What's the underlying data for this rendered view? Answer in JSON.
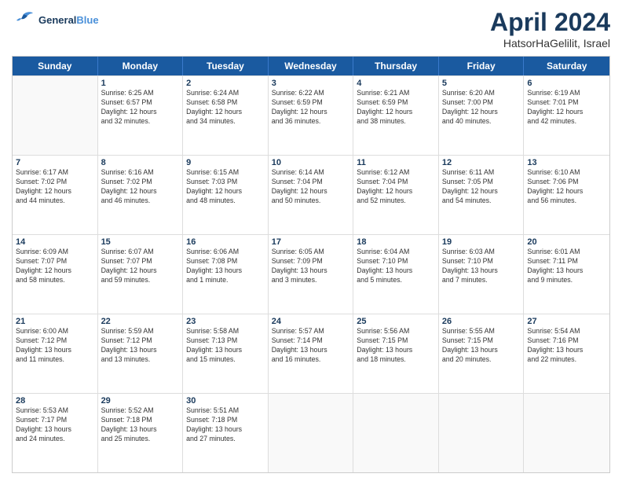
{
  "header": {
    "logo_line1": "General",
    "logo_line2": "Blue",
    "month": "April 2024",
    "location": "HatsorHaGelilit, Israel"
  },
  "days": [
    "Sunday",
    "Monday",
    "Tuesday",
    "Wednesday",
    "Thursday",
    "Friday",
    "Saturday"
  ],
  "weeks": [
    [
      {
        "day": "",
        "text": ""
      },
      {
        "day": "1",
        "text": "Sunrise: 6:25 AM\nSunset: 6:57 PM\nDaylight: 12 hours\nand 32 minutes."
      },
      {
        "day": "2",
        "text": "Sunrise: 6:24 AM\nSunset: 6:58 PM\nDaylight: 12 hours\nand 34 minutes."
      },
      {
        "day": "3",
        "text": "Sunrise: 6:22 AM\nSunset: 6:59 PM\nDaylight: 12 hours\nand 36 minutes."
      },
      {
        "day": "4",
        "text": "Sunrise: 6:21 AM\nSunset: 6:59 PM\nDaylight: 12 hours\nand 38 minutes."
      },
      {
        "day": "5",
        "text": "Sunrise: 6:20 AM\nSunset: 7:00 PM\nDaylight: 12 hours\nand 40 minutes."
      },
      {
        "day": "6",
        "text": "Sunrise: 6:19 AM\nSunset: 7:01 PM\nDaylight: 12 hours\nand 42 minutes."
      }
    ],
    [
      {
        "day": "7",
        "text": "Sunrise: 6:17 AM\nSunset: 7:02 PM\nDaylight: 12 hours\nand 44 minutes."
      },
      {
        "day": "8",
        "text": "Sunrise: 6:16 AM\nSunset: 7:02 PM\nDaylight: 12 hours\nand 46 minutes."
      },
      {
        "day": "9",
        "text": "Sunrise: 6:15 AM\nSunset: 7:03 PM\nDaylight: 12 hours\nand 48 minutes."
      },
      {
        "day": "10",
        "text": "Sunrise: 6:14 AM\nSunset: 7:04 PM\nDaylight: 12 hours\nand 50 minutes."
      },
      {
        "day": "11",
        "text": "Sunrise: 6:12 AM\nSunset: 7:04 PM\nDaylight: 12 hours\nand 52 minutes."
      },
      {
        "day": "12",
        "text": "Sunrise: 6:11 AM\nSunset: 7:05 PM\nDaylight: 12 hours\nand 54 minutes."
      },
      {
        "day": "13",
        "text": "Sunrise: 6:10 AM\nSunset: 7:06 PM\nDaylight: 12 hours\nand 56 minutes."
      }
    ],
    [
      {
        "day": "14",
        "text": "Sunrise: 6:09 AM\nSunset: 7:07 PM\nDaylight: 12 hours\nand 58 minutes."
      },
      {
        "day": "15",
        "text": "Sunrise: 6:07 AM\nSunset: 7:07 PM\nDaylight: 12 hours\nand 59 minutes."
      },
      {
        "day": "16",
        "text": "Sunrise: 6:06 AM\nSunset: 7:08 PM\nDaylight: 13 hours\nand 1 minute."
      },
      {
        "day": "17",
        "text": "Sunrise: 6:05 AM\nSunset: 7:09 PM\nDaylight: 13 hours\nand 3 minutes."
      },
      {
        "day": "18",
        "text": "Sunrise: 6:04 AM\nSunset: 7:10 PM\nDaylight: 13 hours\nand 5 minutes."
      },
      {
        "day": "19",
        "text": "Sunrise: 6:03 AM\nSunset: 7:10 PM\nDaylight: 13 hours\nand 7 minutes."
      },
      {
        "day": "20",
        "text": "Sunrise: 6:01 AM\nSunset: 7:11 PM\nDaylight: 13 hours\nand 9 minutes."
      }
    ],
    [
      {
        "day": "21",
        "text": "Sunrise: 6:00 AM\nSunset: 7:12 PM\nDaylight: 13 hours\nand 11 minutes."
      },
      {
        "day": "22",
        "text": "Sunrise: 5:59 AM\nSunset: 7:12 PM\nDaylight: 13 hours\nand 13 minutes."
      },
      {
        "day": "23",
        "text": "Sunrise: 5:58 AM\nSunset: 7:13 PM\nDaylight: 13 hours\nand 15 minutes."
      },
      {
        "day": "24",
        "text": "Sunrise: 5:57 AM\nSunset: 7:14 PM\nDaylight: 13 hours\nand 16 minutes."
      },
      {
        "day": "25",
        "text": "Sunrise: 5:56 AM\nSunset: 7:15 PM\nDaylight: 13 hours\nand 18 minutes."
      },
      {
        "day": "26",
        "text": "Sunrise: 5:55 AM\nSunset: 7:15 PM\nDaylight: 13 hours\nand 20 minutes."
      },
      {
        "day": "27",
        "text": "Sunrise: 5:54 AM\nSunset: 7:16 PM\nDaylight: 13 hours\nand 22 minutes."
      }
    ],
    [
      {
        "day": "28",
        "text": "Sunrise: 5:53 AM\nSunset: 7:17 PM\nDaylight: 13 hours\nand 24 minutes."
      },
      {
        "day": "29",
        "text": "Sunrise: 5:52 AM\nSunset: 7:18 PM\nDaylight: 13 hours\nand 25 minutes."
      },
      {
        "day": "30",
        "text": "Sunrise: 5:51 AM\nSunset: 7:18 PM\nDaylight: 13 hours\nand 27 minutes."
      },
      {
        "day": "",
        "text": ""
      },
      {
        "day": "",
        "text": ""
      },
      {
        "day": "",
        "text": ""
      },
      {
        "day": "",
        "text": ""
      }
    ]
  ]
}
